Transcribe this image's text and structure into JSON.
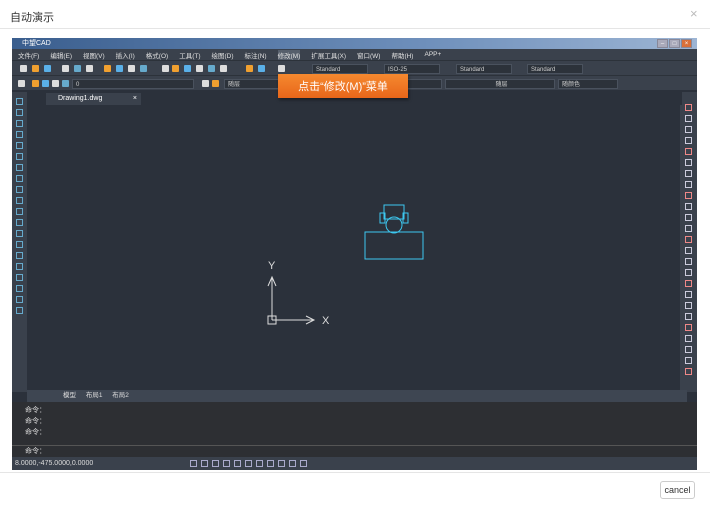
{
  "dialog": {
    "title": "自动演示",
    "close": "×",
    "cancel": "cancel"
  },
  "app": {
    "title": "中望CAD",
    "menu": [
      "文件(F)",
      "编辑(E)",
      "视图(V)",
      "插入(I)",
      "格式(O)",
      "工具(T)",
      "绘图(D)",
      "标注(N)",
      "修改(M)",
      "扩展工具(X)",
      "窗口(W)",
      "帮助(H)",
      "APP+"
    ],
    "toolbar": {
      "text_style": "Standard",
      "dim_style": "ISO-25",
      "table_style": "Standard",
      "mleader_style": "Standard",
      "layer": "0",
      "color": "随层",
      "linetype": "随层",
      "lineweight": "随颜色"
    },
    "doc_tab": "Drawing1.dwg",
    "layout_tabs": [
      "模型",
      "布局1",
      "布局2"
    ],
    "command_history": [
      "命令：",
      "命令：",
      "命令："
    ],
    "command_prompt": "命令：",
    "coordinates": "8.0000,-475.0000,0.0000",
    "axis_x": "X",
    "axis_y": "Y"
  },
  "tooltip": "点击“修改(M)”菜单"
}
